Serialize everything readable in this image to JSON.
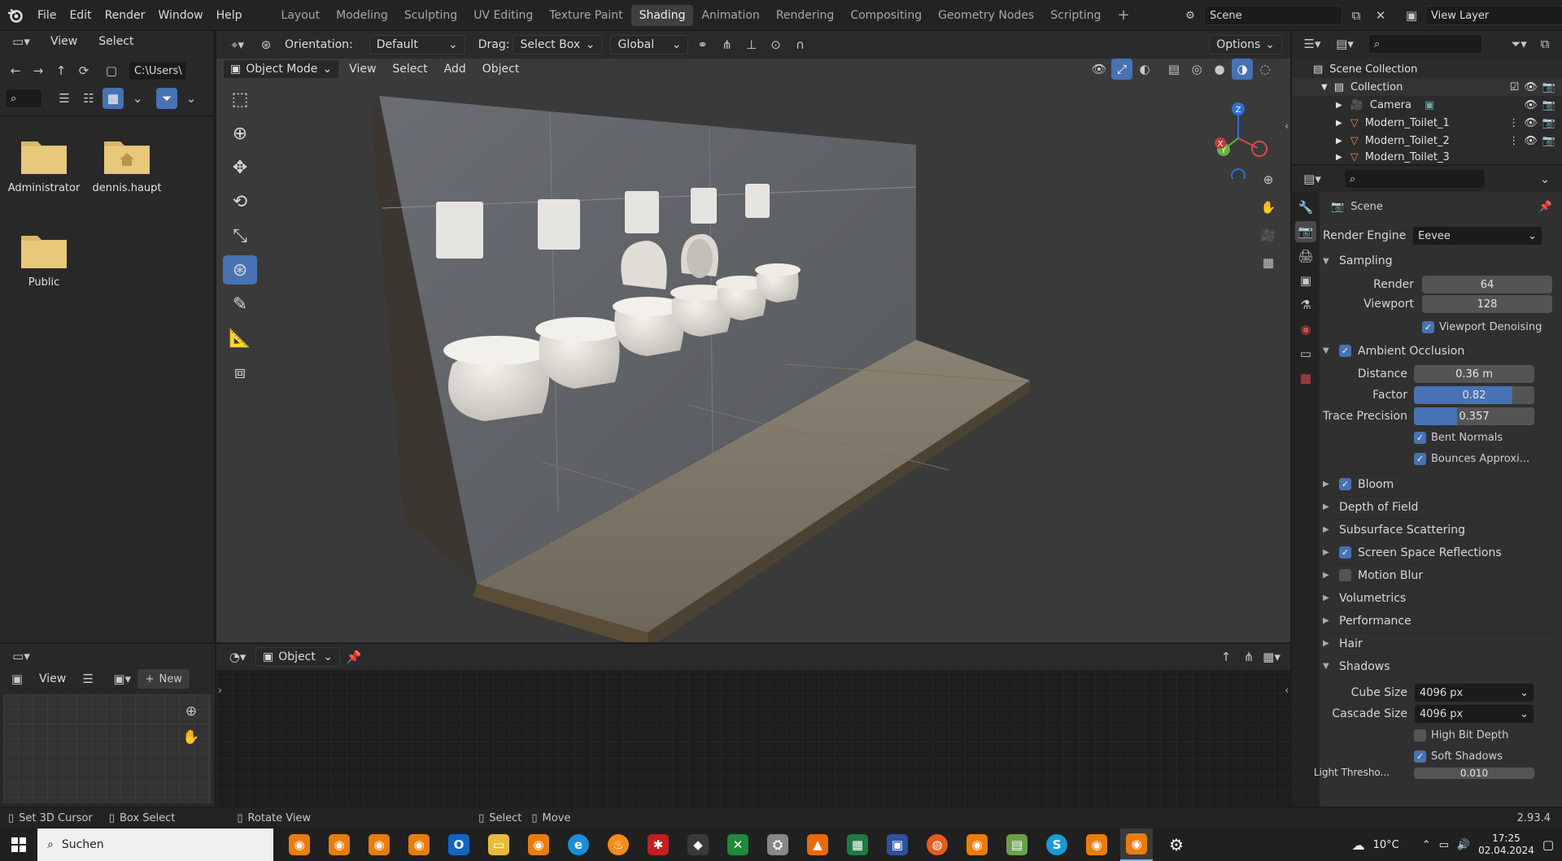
{
  "topbar": {
    "menus": [
      "File",
      "Edit",
      "Render",
      "Window",
      "Help"
    ],
    "workspace_tabs": [
      "Layout",
      "Modeling",
      "Sculpting",
      "UV Editing",
      "Texture Paint",
      "Shading",
      "Animation",
      "Rendering",
      "Compositing",
      "Geometry Nodes",
      "Scripting"
    ],
    "active_tab": "Shading",
    "add_tab": "+",
    "scene": "Scene",
    "view_layer": "View Layer"
  },
  "file_browser": {
    "menus": [
      "View",
      "Select"
    ],
    "path": "C:\\Users\\",
    "items": [
      {
        "name": "Administrator",
        "type": "folder"
      },
      {
        "name": "dennis.haupt",
        "type": "home"
      },
      {
        "name": "Public",
        "type": "folder"
      }
    ]
  },
  "image_editor": {
    "view": "View",
    "new_label": "New",
    "new_plus": "+"
  },
  "viewport": {
    "orientation_label": "Orientation:",
    "orientation_value": "Default",
    "drag_label": "Drag:",
    "drag_value": "Select Box",
    "transform_space": "Global",
    "options": "Options",
    "mode": "Object Mode",
    "menus": [
      "View",
      "Select",
      "Add",
      "Object"
    ],
    "gizmo_axes": {
      "x": "X",
      "y": "Y",
      "z": "Z"
    }
  },
  "node_editor": {
    "object": "Object"
  },
  "outliner": {
    "root": "Scene Collection",
    "collection": "Collection",
    "items": [
      "Camera",
      "Modern_Toilet_1",
      "Modern_Toilet_2",
      "Modern_Toilet_3"
    ]
  },
  "properties": {
    "context": "Scene",
    "render_engine_label": "Render Engine",
    "render_engine": "Eevee",
    "sampling": {
      "title": "Sampling",
      "render_label": "Render",
      "render": "64",
      "viewport_label": "Viewport",
      "viewport": "128",
      "denoise": "Viewport Denoising"
    },
    "ao": {
      "title": "Ambient Occlusion",
      "distance_label": "Distance",
      "distance": "0.36 m",
      "factor_label": "Factor",
      "factor": "0.82",
      "factor_fraction": 0.82,
      "trace_label": "Trace Precision",
      "trace": "0.357",
      "trace_fraction": 0.357,
      "bent": "Bent Normals",
      "bounces": "Bounces Approxi..."
    },
    "sections": [
      {
        "title": "Bloom",
        "checkbox": true,
        "checked": true
      },
      {
        "title": "Depth of Field",
        "checkbox": false
      },
      {
        "title": "Subsurface Scattering",
        "checkbox": false
      },
      {
        "title": "Screen Space Reflections",
        "checkbox": true,
        "checked": true
      },
      {
        "title": "Motion Blur",
        "checkbox": true,
        "checked": false
      },
      {
        "title": "Volumetrics",
        "checkbox": false
      },
      {
        "title": "Performance",
        "checkbox": false
      },
      {
        "title": "Hair",
        "checkbox": false
      }
    ],
    "shadows": {
      "title": "Shadows",
      "cube_label": "Cube Size",
      "cube": "4096 px",
      "cascade_label": "Cascade Size",
      "cascade": "4096 px",
      "high_bit": "High Bit Depth",
      "soft": "Soft Shadows",
      "light_threshold_label": "Light Thresho...",
      "light_threshold": "0.010"
    }
  },
  "statusbar": {
    "cursor": "Set 3D Cursor",
    "box": "Box Select",
    "rotate": "Rotate View",
    "select": "Select",
    "move": "Move",
    "version": "2.93.4"
  },
  "taskbar": {
    "search": "Suchen",
    "temperature": "10°C",
    "time": "17:25",
    "date": "02.04.2024"
  }
}
